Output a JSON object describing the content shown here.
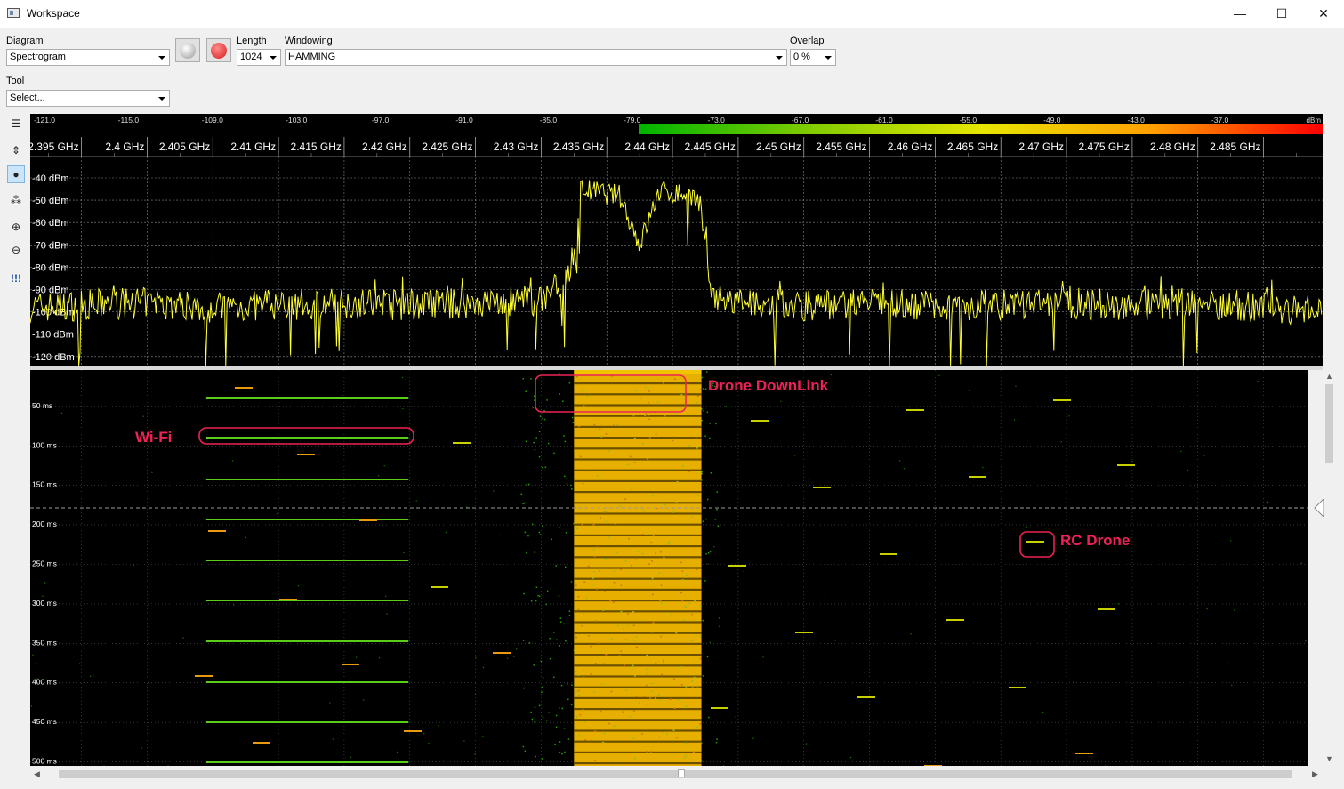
{
  "window": {
    "title": "Workspace",
    "minimize": "—",
    "maximize": "☐",
    "close": "✕"
  },
  "toolbar": {
    "diagram_label": "Diagram",
    "diagram_value": "Spectrogram",
    "length_label": "Length",
    "length_value": "1024",
    "windowing_label": "Windowing",
    "windowing_value": "HAMMING",
    "overlap_label": "Overlap",
    "overlap_value": "0 %",
    "tool_label": "Tool",
    "tool_value": "Select...",
    "colors": {
      "pause": "#9a9a9a",
      "record": "#d81e1e"
    }
  },
  "left_tools": [
    {
      "icon": "list-icon",
      "glyph": "☰",
      "selected": false
    },
    {
      "icon": "fit-height-icon",
      "glyph": "⇕",
      "selected": false
    },
    {
      "icon": "drops-icon",
      "glyph": "●",
      "selected": true
    },
    {
      "icon": "palette-icon",
      "glyph": "⁂",
      "selected": false
    },
    {
      "icon": "zoom-in-icon",
      "glyph": "⊕",
      "selected": false
    },
    {
      "icon": "zoom-out-icon",
      "glyph": "⊖",
      "selected": false
    },
    {
      "icon": "markers-icon",
      "glyph": "!!!",
      "selected": false
    }
  ],
  "color_scale": {
    "unit": "dBm",
    "ticks": [
      "-121.0",
      "-115.0",
      "-109.0",
      "-103.0",
      "-97.0",
      "-91.0",
      "-85.0",
      "-79.0",
      "-73.0",
      "-67.0",
      "-61.0",
      "-55.0",
      "-49.0",
      "-43.0",
      "-37.0"
    ],
    "colors": [
      "#00b400",
      "#80cc00",
      "#e6e600",
      "#ffa000",
      "#ff0000"
    ]
  },
  "frequency_axis": {
    "ticks": [
      "2.395 GHz",
      "2.4 GHz",
      "2.405 GHz",
      "2.41 GHz",
      "2.415 GHz",
      "2.42 GHz",
      "2.425 GHz",
      "2.43 GHz",
      "2.435 GHz",
      "2.44 GHz",
      "2.445 GHz",
      "2.45 GHz",
      "2.455 GHz",
      "2.46 GHz",
      "2.465 GHz",
      "2.47 GHz",
      "2.475 GHz",
      "2.48 GHz",
      "2.485 GHz"
    ]
  },
  "chart_data": {
    "type": "line",
    "xlabel": "",
    "ylabel": "",
    "x_range_ghz": [
      2.3911,
      2.4895
    ],
    "y_ticks": [
      "-40 dBm",
      "-50 dBm",
      "-60 dBm",
      "-70 dBm",
      "-80 dBm",
      "-90 dBm",
      "-100 dBm",
      "-110 dBm",
      "-120 dBm"
    ],
    "ylim": [
      -123,
      -30
    ],
    "series": [
      {
        "color": "#ffff33",
        "noise_floor_dbm": -97,
        "signal_band_ghz": [
          2.4325,
          2.4422
        ],
        "signal_level_dbm": -47,
        "points": [
          [
            2.3911,
            -98
          ],
          [
            2.395,
            -97
          ],
          [
            2.4,
            -96
          ],
          [
            2.405,
            -98
          ],
          [
            2.41,
            -97
          ],
          [
            2.415,
            -96
          ],
          [
            2.42,
            -97
          ],
          [
            2.425,
            -96
          ],
          [
            2.43,
            -95
          ],
          [
            2.4325,
            -80
          ],
          [
            2.433,
            -45
          ],
          [
            2.436,
            -48
          ],
          [
            2.4375,
            -70
          ],
          [
            2.439,
            -46
          ],
          [
            2.442,
            -48
          ],
          [
            2.4425,
            -70
          ],
          [
            2.443,
            -94
          ],
          [
            2.445,
            -96
          ],
          [
            2.45,
            -97
          ],
          [
            2.455,
            -96
          ],
          [
            2.46,
            -97
          ],
          [
            2.465,
            -97
          ],
          [
            2.47,
            -96
          ],
          [
            2.475,
            -97
          ],
          [
            2.48,
            -96
          ],
          [
            2.485,
            -98
          ],
          [
            2.4895,
            -99
          ]
        ]
      }
    ]
  },
  "waterfall": {
    "time_ticks": [
      "50 ms",
      "100 ms",
      "150 ms",
      "200 ms",
      "250 ms",
      "300 ms",
      "350 ms",
      "400 ms",
      "450 ms",
      "500 ms"
    ],
    "range_ms": [
      4,
      505
    ],
    "colors": {
      "band": "#e7b000",
      "band_dark": "#6a5000",
      "wifi": "#5ccc1c",
      "rc": "#c8d000",
      "burst_orange": "#e89a10",
      "speck": "#22a000"
    },
    "drone_band_ghz": [
      2.4325,
      2.4422
    ],
    "wifi_band_ghz": [
      2.4045,
      2.4199
    ],
    "annotations": [
      {
        "label": "Drone DownLink",
        "color": "#ee2255"
      },
      {
        "label": "Wi-Fi",
        "color": "#ee2255"
      },
      {
        "label": "RC Drone",
        "color": "#ee2255"
      }
    ]
  }
}
